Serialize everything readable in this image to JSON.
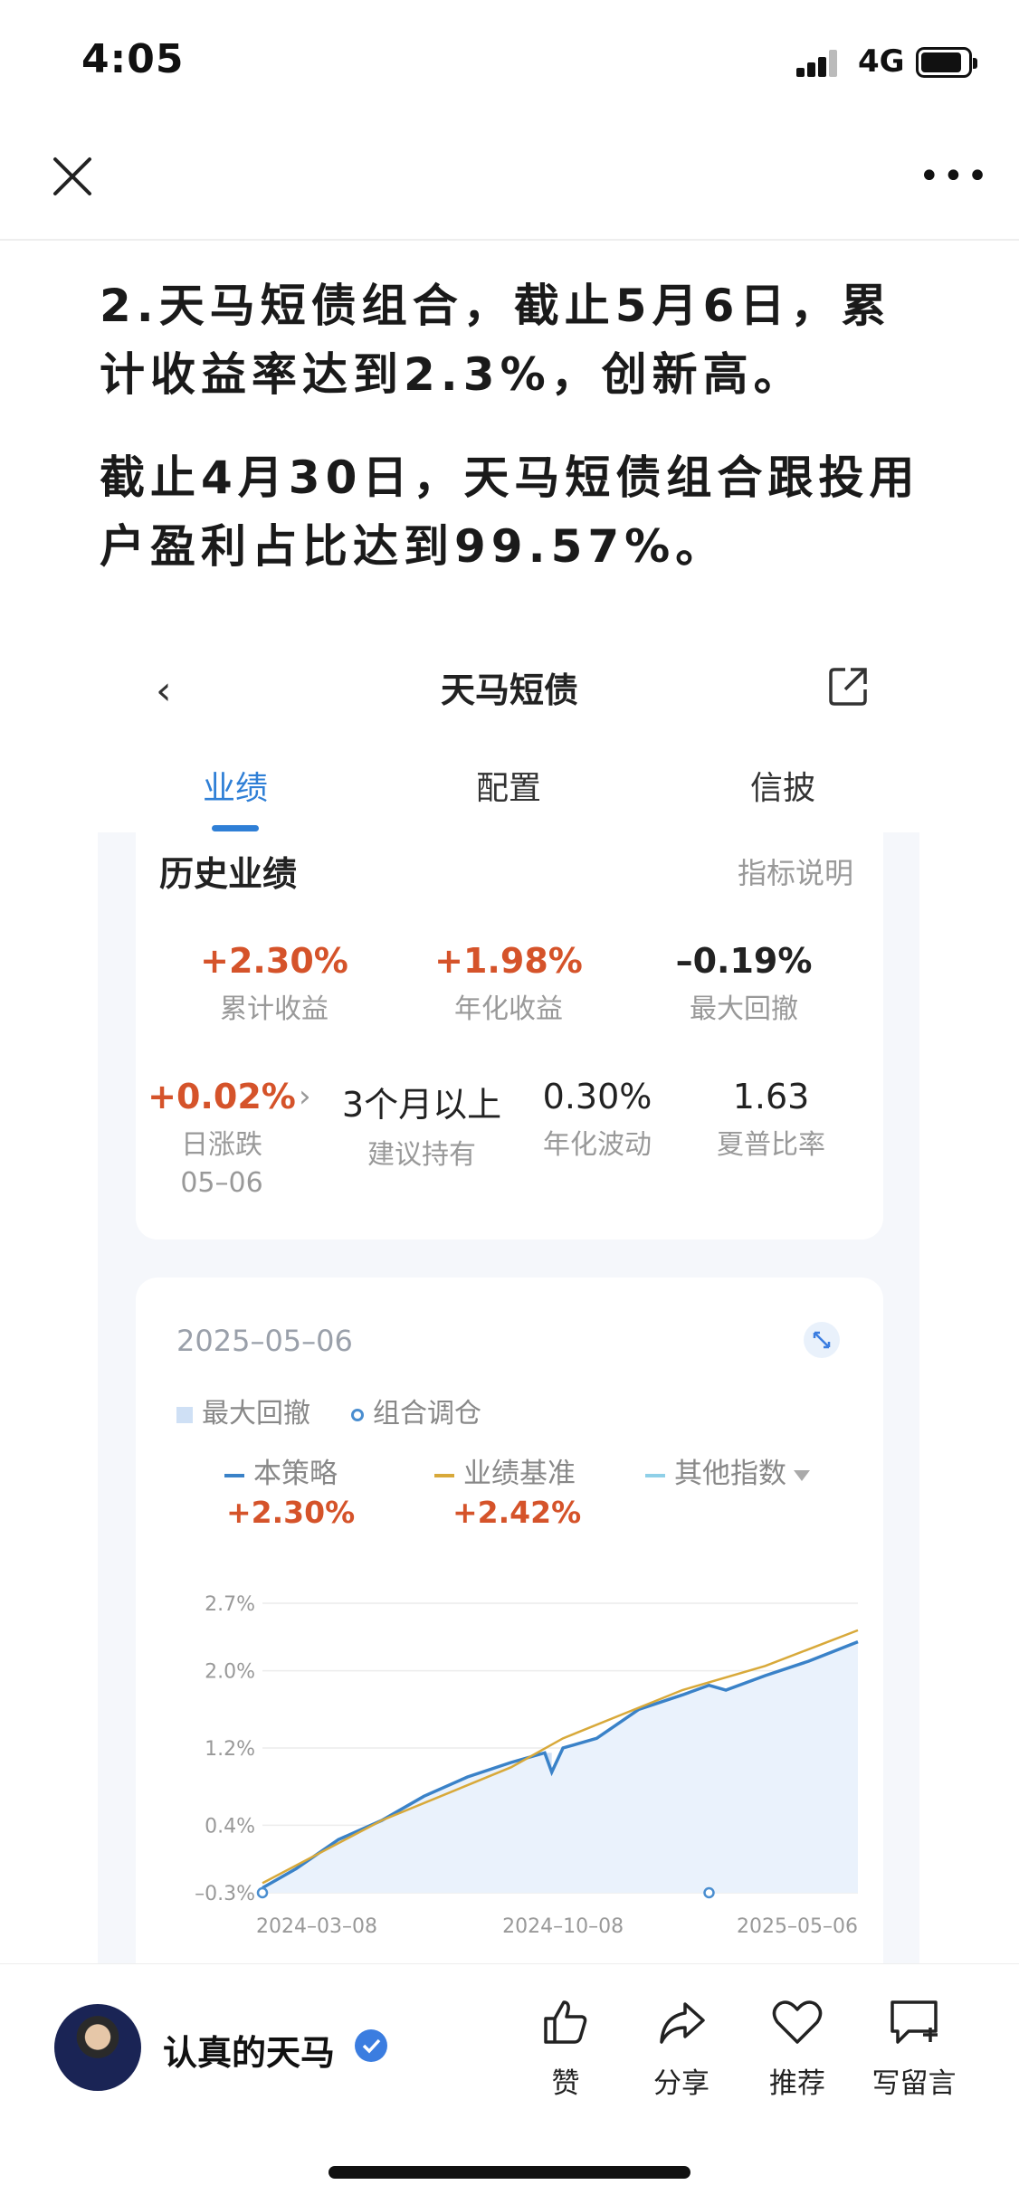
{
  "status_bar": {
    "time": "4:05",
    "network": "4G"
  },
  "article": {
    "paragraph1": "2.天马短债组合，截止5月6日，累计收益率达到2.3%，创新高。",
    "paragraph2": "截止4月30日，天马短债组合跟投用户盈利占比达到99.57%。"
  },
  "embed": {
    "nav_title": "天马短债",
    "tabs": [
      {
        "label": "业绩"
      },
      {
        "label": "配置"
      },
      {
        "label": "信披"
      }
    ],
    "active_tab": "业绩",
    "section_title": "历史业绩",
    "section_link": "指标说明",
    "metrics_row1": [
      {
        "value": "+2.30%",
        "label": "累计收益"
      },
      {
        "value": "+1.98%",
        "label": "年化收益"
      },
      {
        "value": "–0.19%",
        "label": "最大回撤"
      }
    ],
    "metrics_row2": [
      {
        "value": "+0.02%",
        "label": "日涨跌",
        "sub": "05–06"
      },
      {
        "value": "3个月以上",
        "label": "建议持有"
      },
      {
        "value": "0.30%",
        "label": "年化波动"
      },
      {
        "value": "1.63",
        "label": "夏普比率"
      }
    ],
    "chart_date": "2025–05–06",
    "legend_markers": [
      "最大回撤",
      "组合调仓"
    ],
    "series_legend": [
      {
        "name": "本策略",
        "value": "+2.30%",
        "color": "#3a82c8"
      },
      {
        "name": "业绩基准",
        "value": "+2.42%",
        "color": "#d8a93a"
      },
      {
        "name": "其他指数",
        "color": "#8fd0e8"
      }
    ]
  },
  "chart_data": {
    "type": "line",
    "title": "",
    "xlabel": "",
    "ylabel": "",
    "y_tick_labels": [
      "2.7%",
      "2.0%",
      "1.2%",
      "0.4%",
      "–0.3%"
    ],
    "x_tick_labels": [
      "2024–03–08",
      "2024–10–08",
      "2025–05–06"
    ],
    "ylim": [
      -0.3,
      2.7
    ],
    "x_range": [
      "2024-03-08",
      "2025-05-06"
    ],
    "grid": true,
    "series": [
      {
        "name": "本策略",
        "x": [
          "2024-03-08",
          "2024-04-01",
          "2024-05-01",
          "2024-06-01",
          "2024-07-01",
          "2024-08-01",
          "2024-09-01",
          "2024-09-25",
          "2024-09-30",
          "2024-10-08",
          "2024-11-01",
          "2024-12-01",
          "2025-01-01",
          "2025-01-20",
          "2025-02-01",
          "2025-03-01",
          "2025-04-01",
          "2025-05-06"
        ],
        "values": [
          -0.25,
          -0.05,
          0.25,
          0.45,
          0.7,
          0.9,
          1.05,
          1.15,
          0.95,
          1.2,
          1.3,
          1.6,
          1.75,
          1.85,
          1.8,
          1.95,
          2.1,
          2.3
        ]
      },
      {
        "name": "业绩基准",
        "x": [
          "2024-03-08",
          "2024-06-01",
          "2024-09-01",
          "2024-10-08",
          "2025-01-01",
          "2025-03-01",
          "2025-05-06"
        ],
        "values": [
          -0.2,
          0.45,
          1.0,
          1.3,
          1.8,
          2.05,
          2.42
        ]
      }
    ],
    "markers": {
      "最大回撤_band": [
        "2024-09-25",
        "2024-09-30"
      ],
      "组合调仓": [
        "2024-03-08",
        "2025-01-20"
      ]
    }
  },
  "bottom_bar": {
    "author": "认真的天马",
    "actions": [
      {
        "label": "赞"
      },
      {
        "label": "分享"
      },
      {
        "label": "推荐"
      },
      {
        "label": "写留言"
      }
    ]
  }
}
